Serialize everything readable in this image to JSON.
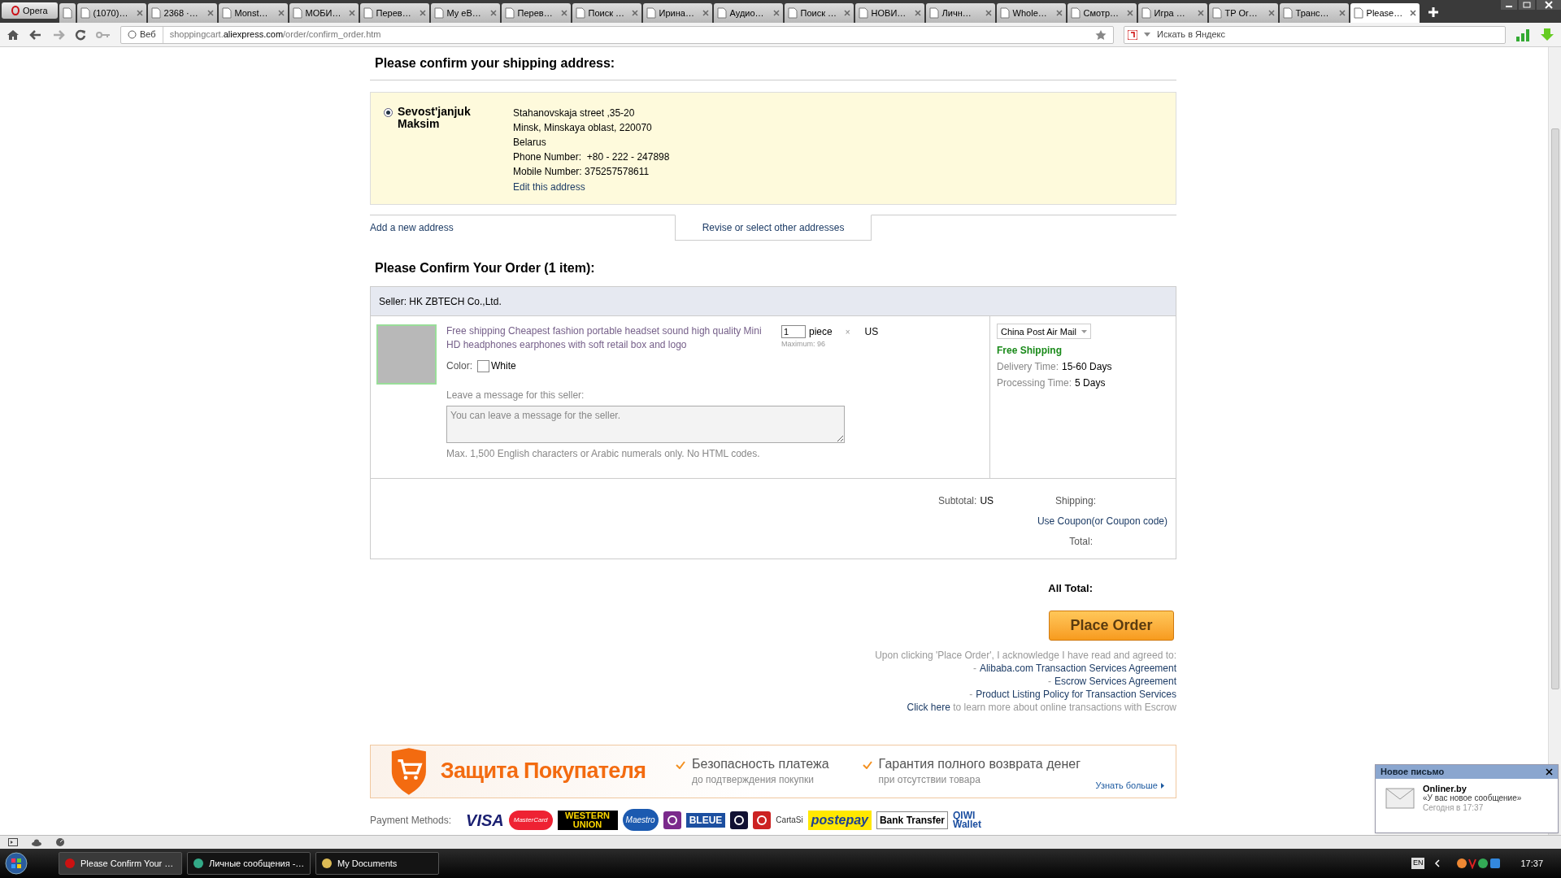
{
  "browser": {
    "menu_button": "Opera",
    "tabs": [
      {
        "selected": false
      },
      {
        "label": "(1070)…",
        "selected": false
      },
      {
        "label": "2368 ·…",
        "selected": false
      },
      {
        "label": "Monst…",
        "selected": false
      },
      {
        "label": "МОБИ…",
        "selected": false
      },
      {
        "label": "Перев…",
        "selected": false
      },
      {
        "label": "My eB…",
        "selected": false
      },
      {
        "label": "Перев…",
        "selected": false
      },
      {
        "label": "Поиск …",
        "selected": false
      },
      {
        "label": "Ирина…",
        "selected": false
      },
      {
        "label": "Аудио…",
        "selected": false
      },
      {
        "label": "Поиск …",
        "selected": false
      },
      {
        "label": "НОВИ…",
        "selected": false
      },
      {
        "label": "Личн…",
        "selected": false
      },
      {
        "label": "Whole…",
        "selected": false
      },
      {
        "label": "Смотр…",
        "selected": false
      },
      {
        "label": "Игра …",
        "selected": false
      },
      {
        "label": "TP Or…",
        "selected": false
      },
      {
        "label": "Транс…",
        "selected": false
      },
      {
        "label": "Please…",
        "selected": true
      }
    ],
    "web_label": "Веб",
    "url": {
      "host_prefix": "shoppingcart.",
      "domain": "aliexpress.com",
      "path": "/order/confirm_order.htm"
    },
    "search_placeholder": "Искать в Яндекс"
  },
  "shipping": {
    "heading": "Please confirm your shipping address:",
    "address": {
      "selected": true,
      "name": "Sevost'janjuk Maksim",
      "lines": [
        "Stahanovskaja street ,35-20",
        "Minsk, Minskaya oblast, 220070",
        "Belarus"
      ],
      "phone_label": "Phone Number:",
      "phone": "+80 - 222 - 247898",
      "mobile_label": "Mobile Number:",
      "mobile": "375257578611",
      "edit_link": "Edit this address"
    },
    "add_link": "Add a new address",
    "revise_tab": "Revise or select other addresses"
  },
  "order": {
    "heading": "Please Confirm Your Order (1 item):",
    "seller": "Seller: HK ZBTECH Co.,Ltd.",
    "item": {
      "title": "Free shipping Cheapest fashion portable headset sound high quality Mini HD headphones earphones with soft retail box and logo",
      "color_label": "Color:",
      "color_value": "White",
      "quantity": "1",
      "unit": "piece",
      "times": "×",
      "price": "US",
      "maximum": "Maximum: 96",
      "message_label": "Leave a message for this seller:",
      "message_placeholder": "You can leave a message for the seller.",
      "message_hint": "Max. 1,500 English characters or Arabic numerals only. No HTML codes.",
      "shipping_method": "China Post Air Mail",
      "free_shipping": "Free Shipping",
      "delivery_label": "Delivery Time:",
      "delivery": "15-60 Days",
      "processing_label": "Processing Time:",
      "processing": "5 Days"
    },
    "subtotal_label": "Subtotal:",
    "subtotal": "US",
    "shipping_label": "Shipping:",
    "coupon_link": "Use Coupon(or Coupon code)",
    "total_label": "Total:"
  },
  "checkout": {
    "all_total_label": "All Total:",
    "place_order": "Place Order",
    "agree_text": "Upon clicking 'Place Order', I acknowledge I have read and agreed to:",
    "agreements": [
      {
        "dash": "-",
        "label": "Alibaba.com Transaction Services Agreement"
      },
      {
        "dash": "-",
        "label": "Escrow Services Agreement"
      },
      {
        "dash": "-",
        "label": "Product Listing Policy for Transaction Services"
      }
    ],
    "click_here": "Click here",
    "learn_more": " to learn more about online transactions with Escrow"
  },
  "protection": {
    "title": "Защита Покупателя",
    "features": [
      {
        "title": "Безопасность платежа",
        "subtitle": "до подтверждения покупки"
      },
      {
        "title": "Гарантия полного возврата денег",
        "subtitle": "при отсутствии товара"
      }
    ],
    "more_link": "Узнать больше"
  },
  "payment": {
    "label": "Payment Methods:",
    "methods": [
      {
        "kind": "text",
        "label": "VISA"
      },
      {
        "kind": "text",
        "label": "MasterCard"
      },
      {
        "kind": "text",
        "label": "WESTERN UNION"
      },
      {
        "kind": "text",
        "label": "Maestro"
      },
      {
        "kind": "mark",
        "color": "#7b2a8c"
      },
      {
        "kind": "text",
        "label": "BLEUE"
      },
      {
        "kind": "mark",
        "color": "#111133"
      },
      {
        "kind": "mark",
        "color": "#cc2222"
      },
      {
        "kind": "text",
        "label": "CartaSi"
      },
      {
        "kind": "text",
        "label": "postepay"
      },
      {
        "kind": "text",
        "label": "Bank Transfer"
      },
      {
        "kind": "text",
        "label": "QIWI Wallet"
      }
    ]
  },
  "taskbar": {
    "tasks": [
      {
        "label": "Please Confirm Your …",
        "selected": true
      },
      {
        "label": "Личные сообщения -…",
        "selected": false
      },
      {
        "label": "My Documents",
        "selected": false
      }
    ],
    "language": "EN",
    "clock": "17:37"
  },
  "notification": {
    "title": "Новое письмо",
    "sender": "Onliner.by",
    "message": "«У вас новое сообщение»",
    "time": "Сегодня в 17:37"
  }
}
